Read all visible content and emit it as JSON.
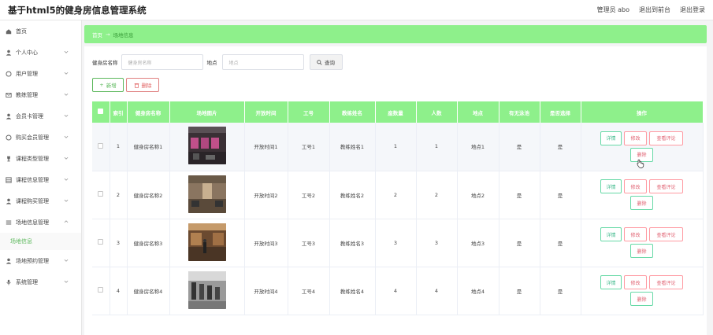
{
  "header": {
    "title": "基于html5的健身房信息管理系统",
    "links": [
      "管理员 abo",
      "退出到前台",
      "退出登录"
    ]
  },
  "sidebar": {
    "items": [
      {
        "label": "首页",
        "icon": "home-icon",
        "chevron": false
      },
      {
        "label": "个人中心",
        "icon": "user-icon",
        "chevron": true
      },
      {
        "label": "用户管理",
        "icon": "circle-icon",
        "chevron": true
      },
      {
        "label": "教练管理",
        "icon": "envelope-icon",
        "chevron": true
      },
      {
        "label": "会员卡管理",
        "icon": "user-icon",
        "chevron": true
      },
      {
        "label": "购买会员管理",
        "icon": "circle-icon",
        "chevron": true
      },
      {
        "label": "课程类型管理",
        "icon": "trophy-icon",
        "chevron": true
      },
      {
        "label": "课程信息管理",
        "icon": "grid-icon",
        "chevron": true
      },
      {
        "label": "课程购买管理",
        "icon": "user-icon",
        "chevron": true
      },
      {
        "label": "场地信息管理",
        "icon": "list-icon",
        "chevron": true,
        "expanded": true,
        "sub": "场地信息"
      },
      {
        "label": "场地预约管理",
        "icon": "user-icon",
        "chevron": true
      },
      {
        "label": "系统管理",
        "icon": "mic-icon",
        "chevron": true
      }
    ]
  },
  "breadcrumb": {
    "home": "首页",
    "sep": "→",
    "current": "场地信息"
  },
  "search": {
    "label1": "健身房名称",
    "placeholder1": "健身房名称",
    "label2": "地点",
    "placeholder2": "地点",
    "button": "查询"
  },
  "actions": {
    "add": "新增",
    "delete": "删除"
  },
  "table": {
    "headers": [
      "",
      "索引",
      "健身房名称",
      "场地图片",
      "开放时间",
      "工号",
      "教练姓名",
      "座数量",
      "人数",
      "地点",
      "有无泳池",
      "是否选择",
      "操作"
    ],
    "rows": [
      {
        "index": "1",
        "name": "健身房名称1",
        "time": "开放时间1",
        "no": "工号1",
        "coach": "教练姓名1",
        "seats": "1",
        "people": "1",
        "place": "地点1",
        "pool": "是",
        "chosen": "是",
        "img": "gym-photo-pink"
      },
      {
        "index": "2",
        "name": "健身房名称2",
        "time": "开放时间2",
        "no": "工号2",
        "coach": "教练姓名2",
        "seats": "2",
        "people": "2",
        "place": "地点2",
        "pool": "是",
        "chosen": "是",
        "img": "gym-photo-brown"
      },
      {
        "index": "3",
        "name": "健身房名称3",
        "time": "开放时间3",
        "no": "工号3",
        "coach": "教练姓名3",
        "seats": "3",
        "people": "3",
        "place": "地点3",
        "pool": "是",
        "chosen": "是",
        "img": "gym-photo-wood"
      },
      {
        "index": "4",
        "name": "健身房名称4",
        "time": "开放时间4",
        "no": "工号4",
        "coach": "教练姓名4",
        "seats": "4",
        "people": "4",
        "place": "地点4",
        "pool": "是",
        "chosen": "是",
        "img": "gym-photo-gray"
      }
    ],
    "ops": {
      "detail": "详情",
      "edit": "修改",
      "review": "查看评论",
      "delete": "删除"
    }
  },
  "colors": {
    "accent": "#8ef08b",
    "accent_text": "#5cb85c",
    "danger": "#e06070",
    "success_border": "#66d9a6"
  }
}
